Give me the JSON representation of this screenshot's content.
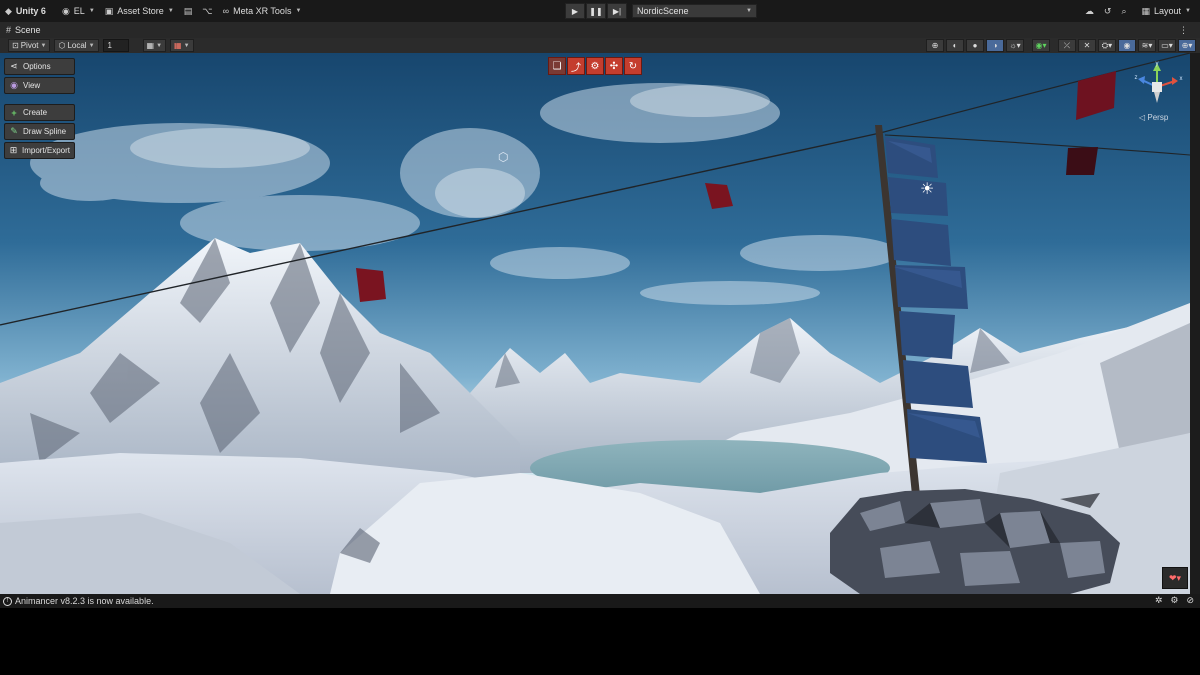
{
  "toolbar": {
    "app_name": "Unity 6",
    "account": "EL",
    "asset_store": "Asset Store",
    "meta_tools": "Meta XR Tools",
    "scene_name": "NordicScene",
    "layout": "Layout"
  },
  "scene_tab": {
    "label": "Scene"
  },
  "scene_toolbar": {
    "pivot": "Pivot",
    "local": "Local",
    "grid_value": "1"
  },
  "overlay": {
    "options": "Options",
    "view": "View",
    "create": "Create",
    "draw_spline": "Draw Spline",
    "import_export": "Import/Export"
  },
  "gizmo": {
    "projection": "Persp",
    "axis_x": "x",
    "axis_y": "y",
    "axis_z": "z"
  },
  "status": {
    "message": "Animancer v8.2.3 is now available."
  },
  "colors": {
    "toolbar_bg": "#191919",
    "tool_strip_red": "#c43d2e",
    "sky_top": "#1e4f7a",
    "snow": "#e6ebf2"
  },
  "icons": {
    "unity_logo": "unity-logo-icon",
    "play": "play-icon",
    "pause": "pause-icon",
    "step": "step-icon",
    "light": "light-icon",
    "cube": "cube-icon"
  }
}
